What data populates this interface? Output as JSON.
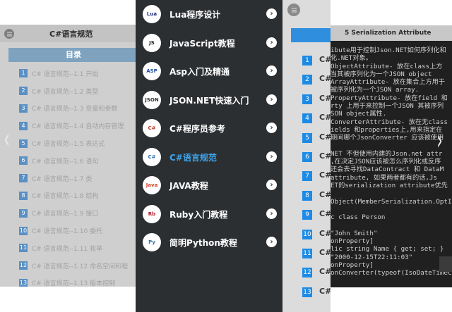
{
  "left": {
    "header_title": "C#语言规范",
    "toc_title": "目录",
    "items": [
      {
        "num": "1",
        "text": "C# 语言规范--1.1 开始"
      },
      {
        "num": "2",
        "text": "C# 语言规范--1.2 类型"
      },
      {
        "num": "3",
        "text": "C# 语言规范--1.3 变量和参数"
      },
      {
        "num": "4",
        "text": "C# 语言规范--1.4 自动内存管理"
      },
      {
        "num": "5",
        "text": "C# 语言规范--1.5 表达式"
      },
      {
        "num": "6",
        "text": "C# 语言规范--1.6 语句"
      },
      {
        "num": "7",
        "text": "C# 语言规范--1.7 类"
      },
      {
        "num": "8",
        "text": "C# 语言规范--1.8 结构"
      },
      {
        "num": "9",
        "text": "C# 语言规范--1.9 接口"
      },
      {
        "num": "10",
        "text": "C# 语言规范--1.10 委托"
      },
      {
        "num": "11",
        "text": "C# 语言规范--1.11 枚举"
      },
      {
        "num": "12",
        "text": "C# 语言规范--1.12 命名空间和程"
      },
      {
        "num": "13",
        "text": "C# 语言规范--1.13 版本控制"
      }
    ]
  },
  "menu": {
    "items": [
      {
        "label": "Lua程序设计",
        "icon": "lua-logo-icon",
        "logo_text": "Lua",
        "logo_color": "#1a2a7a"
      },
      {
        "label": "JavaScript教程",
        "icon": "rhino-logo-icon",
        "logo_text": "JS",
        "logo_color": "#1c1c1c"
      },
      {
        "label": "Asp入门及精通",
        "icon": "asp-logo-icon",
        "logo_text": "ASP",
        "logo_color": "#1f4fa0"
      },
      {
        "label": "JSON.NET快速入门",
        "icon": "json-logo-icon",
        "logo_text": "JSON",
        "logo_color": "#333333"
      },
      {
        "label": "C#程序员参考",
        "icon": "csharp-ref-logo-icon",
        "logo_text": "C#",
        "logo_color": "#c0392b"
      },
      {
        "label": "C#语言规范",
        "icon": "csharp-spec-logo-icon",
        "logo_text": "C#",
        "logo_color": "#2a6fb0",
        "active": true
      },
      {
        "label": "JAVA教程",
        "icon": "java-logo-icon",
        "logo_text": "Java",
        "logo_color": "#d6452a"
      },
      {
        "label": "Ruby入门教程",
        "icon": "ruby-logo-icon",
        "logo_text": "Rb",
        "logo_color": "#b3182b"
      },
      {
        "label": "简明Python教程",
        "icon": "python-logo-icon",
        "logo_text": "Py",
        "logo_color": "#3572a5"
      }
    ],
    "arrow_glyph": "›"
  },
  "mid_right": {
    "items": [
      {
        "num": "1",
        "text": "C#"
      },
      {
        "num": "2",
        "text": "C#"
      },
      {
        "num": "3",
        "text": "C#"
      },
      {
        "num": "4",
        "text": "C#"
      },
      {
        "num": "5",
        "text": "C#"
      },
      {
        "num": "6",
        "text": "C#"
      },
      {
        "num": "7",
        "text": "C#"
      },
      {
        "num": "8",
        "text": "C#"
      },
      {
        "num": "9",
        "text": "C#"
      },
      {
        "num": "10",
        "text": "C#"
      },
      {
        "num": "11",
        "text": "C#"
      },
      {
        "num": "12",
        "text": "C#"
      },
      {
        "num": "13",
        "text": "C#"
      }
    ]
  },
  "right": {
    "header_title": "5 Serialization Attribute",
    "code_lines": [
      "ibute用于控制Json.NET如何序列化和",
      "化.NET对象。",
      "ObjectAttribute- 放在class上方",
      "当其被序列化为一个JSON object",
      "ArrayAttribute- 放在集合上方用于",
      "被序列化为一个JSON array.",
      "PropertyAttribute- 放在field 和",
      "rty 上用于来控制一个JSON 其被序列",
      "SON object属性.",
      "ConverterAttribute- 放在无class",
      "ields 和properties上,用来指定在",
      "期间哪个JsonConverter 应该被使用",
      "",
      "NET 不但使用内建的Json.net attr",
      ",在决定JSON应该被怎么序列化或反序",
      "还会去寻找DataContract 和 DataM",
      "attribute, 如果两者都有的话,Js",
      "ET的serialization attribute优先",
      "",
      "Object(MemberSerialization.OptIn)",
      "",
      "c class Person",
      "",
      "\"John Smith\"",
      "onProperty]",
      "lic string Name { get; set; }",
      "\"2000-12-15T22:11:03\"",
      "onProperty]",
      "onConverter(typeof(IsoDateTimeConv"
    ]
  },
  "nav": {
    "prev_glyph": "‹",
    "next_glyph": "›"
  }
}
